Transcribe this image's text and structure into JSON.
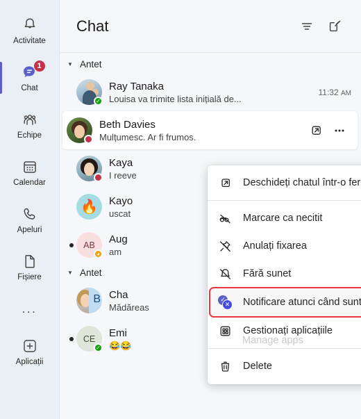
{
  "rail": {
    "items": [
      {
        "label": "Activitate",
        "icon": "bell-icon",
        "active": false,
        "badge": ""
      },
      {
        "label": "Chat",
        "icon": "chat-icon",
        "active": true,
        "badge": "1"
      },
      {
        "label": "Echipe",
        "icon": "teams-icon",
        "active": false,
        "badge": ""
      },
      {
        "label": "Calendar",
        "icon": "calendar-icon",
        "active": false,
        "badge": ""
      },
      {
        "label": "Apeluri",
        "icon": "phone-icon",
        "active": false,
        "badge": ""
      },
      {
        "label": "Fișiere",
        "icon": "file-icon",
        "active": false,
        "badge": ""
      }
    ],
    "more_label": "...",
    "apps_label": "Aplicații",
    "active_accent": "#5b5fc7",
    "badge_color": "#c4314b"
  },
  "header": {
    "title": "Chat",
    "filter_icon": "filter-icon",
    "compose_icon": "compose-icon"
  },
  "chat_list": {
    "groups": [
      {
        "label": "Antet",
        "rows": [
          {
            "name": "Ray Tanaka",
            "message": "Louisa va trimite lista inițială de...",
            "time": "11:32",
            "ampm": "AM",
            "presence": "available",
            "avatar": "ph-ray",
            "initials": "",
            "unread": false,
            "selected": false
          },
          {
            "name": "Beth Davies",
            "message": "Mulțumesc. Ar fi frumos.",
            "time": "",
            "ampm": "",
            "presence": "busy",
            "avatar": "ph-beth",
            "initials": "",
            "unread": false,
            "selected": true,
            "actions": [
              "popout-icon",
              "more-icon"
            ]
          },
          {
            "name": "Kaya",
            "message": "I reeve",
            "time": "",
            "ampm": "",
            "presence": "busy",
            "avatar": "ph-kaya",
            "initials": "",
            "unread": false,
            "selected": false
          },
          {
            "name": "Kayo",
            "message": "uscat",
            "time": "",
            "ampm": "",
            "presence": "",
            "avatar": "ph-kayo",
            "initials": "🔥",
            "unread": false,
            "selected": false
          },
          {
            "name": "Aug",
            "message": "am",
            "time": "",
            "ampm": "",
            "presence": "away",
            "avatar": "ph-ab",
            "initials": "AB",
            "unread": true,
            "selected": false
          }
        ]
      },
      {
        "label": "Antet",
        "rows": [
          {
            "name": "Cha",
            "message": "Mădăreas",
            "time": "",
            "ampm": "",
            "presence": "",
            "avatar": "ph-cha",
            "initials": "B",
            "unread": false,
            "selected": false
          },
          {
            "name": "Emi",
            "message": "😂😂",
            "time": "",
            "ampm": "",
            "presence": "available",
            "avatar": "ph-ce",
            "initials": "CE",
            "unread": true,
            "selected": false
          }
        ]
      }
    ]
  },
  "context_menu": {
    "items": [
      {
        "label": "Deschideți chatul într-o fereastră nouă",
        "icon": "popout-icon",
        "highlighted": false,
        "separator_after": true
      },
      {
        "label": "Marcare ca necitit",
        "icon": "mark-unread-icon",
        "highlighted": false,
        "separator_after": false
      },
      {
        "label": "Anulați fixarea",
        "icon": "unpin-icon",
        "highlighted": false,
        "separator_after": false
      },
      {
        "label": "Fără sunet",
        "icon": "mute-icon",
        "highlighted": false,
        "separator_after": false
      },
      {
        "label": "Notificare atunci când sunt disponibile",
        "icon": "notify-when-available-icon",
        "highlighted": true,
        "separator_after": false
      },
      {
        "label": "Gestionați aplicațiile",
        "icon": "manage-apps-icon",
        "highlighted": false,
        "separator_after": true,
        "ghost": "Manage apps"
      },
      {
        "label": "Delete",
        "icon": "trash-icon",
        "highlighted": false,
        "separator_after": false
      }
    ],
    "highlight_color": "#e8383d"
  }
}
